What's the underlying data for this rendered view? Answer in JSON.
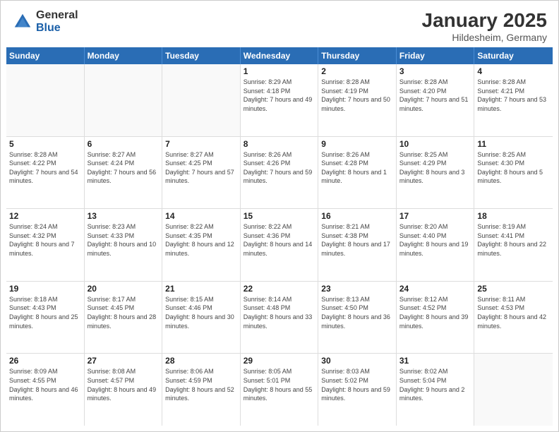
{
  "header": {
    "logo": {
      "general": "General",
      "blue": "Blue"
    },
    "title": "January 2025",
    "location": "Hildesheim, Germany"
  },
  "weekdays": [
    "Sunday",
    "Monday",
    "Tuesday",
    "Wednesday",
    "Thursday",
    "Friday",
    "Saturday"
  ],
  "weeks": [
    [
      {
        "day": "",
        "sunrise": "",
        "sunset": "",
        "daylight": ""
      },
      {
        "day": "",
        "sunrise": "",
        "sunset": "",
        "daylight": ""
      },
      {
        "day": "",
        "sunrise": "",
        "sunset": "",
        "daylight": ""
      },
      {
        "day": "1",
        "sunrise": "Sunrise: 8:29 AM",
        "sunset": "Sunset: 4:18 PM",
        "daylight": "Daylight: 7 hours and 49 minutes."
      },
      {
        "day": "2",
        "sunrise": "Sunrise: 8:28 AM",
        "sunset": "Sunset: 4:19 PM",
        "daylight": "Daylight: 7 hours and 50 minutes."
      },
      {
        "day": "3",
        "sunrise": "Sunrise: 8:28 AM",
        "sunset": "Sunset: 4:20 PM",
        "daylight": "Daylight: 7 hours and 51 minutes."
      },
      {
        "day": "4",
        "sunrise": "Sunrise: 8:28 AM",
        "sunset": "Sunset: 4:21 PM",
        "daylight": "Daylight: 7 hours and 53 minutes."
      }
    ],
    [
      {
        "day": "5",
        "sunrise": "Sunrise: 8:28 AM",
        "sunset": "Sunset: 4:22 PM",
        "daylight": "Daylight: 7 hours and 54 minutes."
      },
      {
        "day": "6",
        "sunrise": "Sunrise: 8:27 AM",
        "sunset": "Sunset: 4:24 PM",
        "daylight": "Daylight: 7 hours and 56 minutes."
      },
      {
        "day": "7",
        "sunrise": "Sunrise: 8:27 AM",
        "sunset": "Sunset: 4:25 PM",
        "daylight": "Daylight: 7 hours and 57 minutes."
      },
      {
        "day": "8",
        "sunrise": "Sunrise: 8:26 AM",
        "sunset": "Sunset: 4:26 PM",
        "daylight": "Daylight: 7 hours and 59 minutes."
      },
      {
        "day": "9",
        "sunrise": "Sunrise: 8:26 AM",
        "sunset": "Sunset: 4:28 PM",
        "daylight": "Daylight: 8 hours and 1 minute."
      },
      {
        "day": "10",
        "sunrise": "Sunrise: 8:25 AM",
        "sunset": "Sunset: 4:29 PM",
        "daylight": "Daylight: 8 hours and 3 minutes."
      },
      {
        "day": "11",
        "sunrise": "Sunrise: 8:25 AM",
        "sunset": "Sunset: 4:30 PM",
        "daylight": "Daylight: 8 hours and 5 minutes."
      }
    ],
    [
      {
        "day": "12",
        "sunrise": "Sunrise: 8:24 AM",
        "sunset": "Sunset: 4:32 PM",
        "daylight": "Daylight: 8 hours and 7 minutes."
      },
      {
        "day": "13",
        "sunrise": "Sunrise: 8:23 AM",
        "sunset": "Sunset: 4:33 PM",
        "daylight": "Daylight: 8 hours and 10 minutes."
      },
      {
        "day": "14",
        "sunrise": "Sunrise: 8:22 AM",
        "sunset": "Sunset: 4:35 PM",
        "daylight": "Daylight: 8 hours and 12 minutes."
      },
      {
        "day": "15",
        "sunrise": "Sunrise: 8:22 AM",
        "sunset": "Sunset: 4:36 PM",
        "daylight": "Daylight: 8 hours and 14 minutes."
      },
      {
        "day": "16",
        "sunrise": "Sunrise: 8:21 AM",
        "sunset": "Sunset: 4:38 PM",
        "daylight": "Daylight: 8 hours and 17 minutes."
      },
      {
        "day": "17",
        "sunrise": "Sunrise: 8:20 AM",
        "sunset": "Sunset: 4:40 PM",
        "daylight": "Daylight: 8 hours and 19 minutes."
      },
      {
        "day": "18",
        "sunrise": "Sunrise: 8:19 AM",
        "sunset": "Sunset: 4:41 PM",
        "daylight": "Daylight: 8 hours and 22 minutes."
      }
    ],
    [
      {
        "day": "19",
        "sunrise": "Sunrise: 8:18 AM",
        "sunset": "Sunset: 4:43 PM",
        "daylight": "Daylight: 8 hours and 25 minutes."
      },
      {
        "day": "20",
        "sunrise": "Sunrise: 8:17 AM",
        "sunset": "Sunset: 4:45 PM",
        "daylight": "Daylight: 8 hours and 28 minutes."
      },
      {
        "day": "21",
        "sunrise": "Sunrise: 8:15 AM",
        "sunset": "Sunset: 4:46 PM",
        "daylight": "Daylight: 8 hours and 30 minutes."
      },
      {
        "day": "22",
        "sunrise": "Sunrise: 8:14 AM",
        "sunset": "Sunset: 4:48 PM",
        "daylight": "Daylight: 8 hours and 33 minutes."
      },
      {
        "day": "23",
        "sunrise": "Sunrise: 8:13 AM",
        "sunset": "Sunset: 4:50 PM",
        "daylight": "Daylight: 8 hours and 36 minutes."
      },
      {
        "day": "24",
        "sunrise": "Sunrise: 8:12 AM",
        "sunset": "Sunset: 4:52 PM",
        "daylight": "Daylight: 8 hours and 39 minutes."
      },
      {
        "day": "25",
        "sunrise": "Sunrise: 8:11 AM",
        "sunset": "Sunset: 4:53 PM",
        "daylight": "Daylight: 8 hours and 42 minutes."
      }
    ],
    [
      {
        "day": "26",
        "sunrise": "Sunrise: 8:09 AM",
        "sunset": "Sunset: 4:55 PM",
        "daylight": "Daylight: 8 hours and 46 minutes."
      },
      {
        "day": "27",
        "sunrise": "Sunrise: 8:08 AM",
        "sunset": "Sunset: 4:57 PM",
        "daylight": "Daylight: 8 hours and 49 minutes."
      },
      {
        "day": "28",
        "sunrise": "Sunrise: 8:06 AM",
        "sunset": "Sunset: 4:59 PM",
        "daylight": "Daylight: 8 hours and 52 minutes."
      },
      {
        "day": "29",
        "sunrise": "Sunrise: 8:05 AM",
        "sunset": "Sunset: 5:01 PM",
        "daylight": "Daylight: 8 hours and 55 minutes."
      },
      {
        "day": "30",
        "sunrise": "Sunrise: 8:03 AM",
        "sunset": "Sunset: 5:02 PM",
        "daylight": "Daylight: 8 hours and 59 minutes."
      },
      {
        "day": "31",
        "sunrise": "Sunrise: 8:02 AM",
        "sunset": "Sunset: 5:04 PM",
        "daylight": "Daylight: 9 hours and 2 minutes."
      },
      {
        "day": "",
        "sunrise": "",
        "sunset": "",
        "daylight": ""
      }
    ]
  ]
}
